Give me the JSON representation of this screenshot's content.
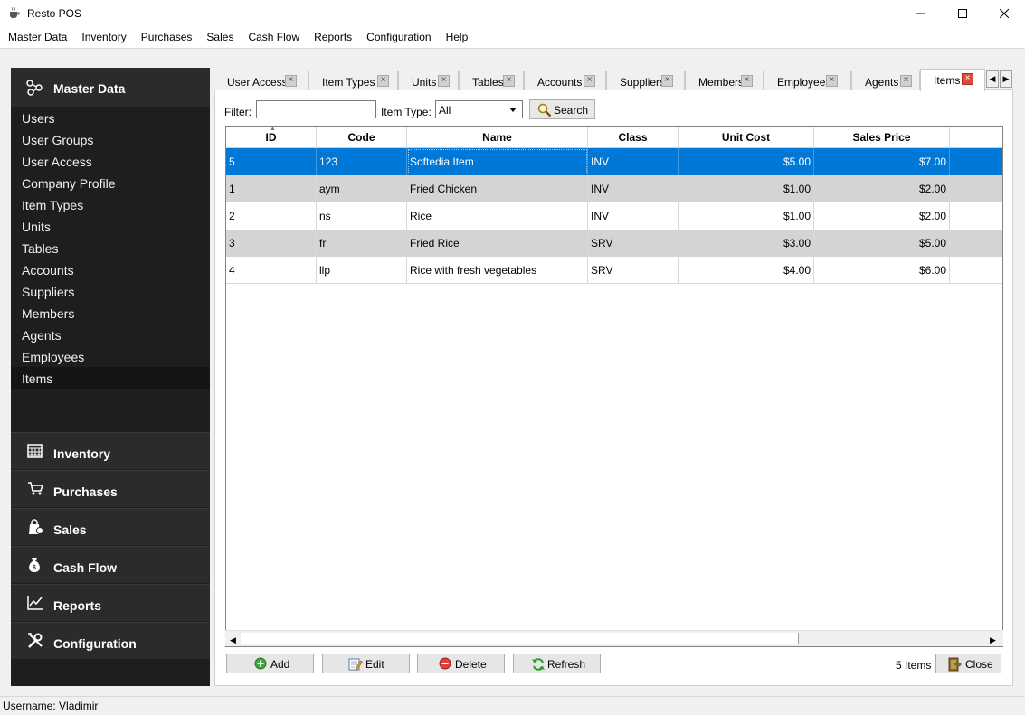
{
  "window": {
    "title": "Resto POS"
  },
  "menu": [
    "Master Data",
    "Inventory",
    "Purchases",
    "Sales",
    "Cash Flow",
    "Reports",
    "Configuration",
    "Help"
  ],
  "sidebar": {
    "header": "Master Data",
    "items": [
      "Users",
      "User Groups",
      "User Access",
      "Company Profile",
      "Item Types",
      "Units",
      "Tables",
      "Accounts",
      "Suppliers",
      "Members",
      "Agents",
      "Employees",
      "Items"
    ],
    "active_item": "Items",
    "sections": [
      "Inventory",
      "Purchases",
      "Sales",
      "Cash Flow",
      "Reports",
      "Configuration"
    ]
  },
  "tabs": [
    "User Access",
    "Item Types",
    "Units",
    "Tables",
    "Accounts",
    "Suppliers",
    "Members",
    "Employees",
    "Agents",
    "Items"
  ],
  "active_tab": "Items",
  "filter": {
    "filter_label": "Filter:",
    "filter_value": "",
    "item_type_label": "Item Type:",
    "item_type_value": "All",
    "search_label": "Search"
  },
  "table": {
    "columns": [
      "ID",
      "Code",
      "Name",
      "Class",
      "Unit Cost",
      "Sales Price"
    ],
    "rows": [
      [
        "5",
        "123",
        "Softedia Item",
        "INV",
        "$5.00",
        "$7.00"
      ],
      [
        "1",
        "aym",
        "Fried Chicken",
        "INV",
        "$1.00",
        "$2.00"
      ],
      [
        "2",
        "ns",
        "Rice",
        "INV",
        "$1.00",
        "$2.00"
      ],
      [
        "3",
        "fr",
        "Fried Rice",
        "SRV",
        "$3.00",
        "$5.00"
      ],
      [
        "4",
        "llp",
        "Rice with fresh vegetables",
        "SRV",
        "$4.00",
        "$6.00"
      ]
    ],
    "selected_row": 0
  },
  "buttons": {
    "add": "Add",
    "edit": "Edit",
    "delete": "Delete",
    "refresh": "Refresh",
    "close": "Close"
  },
  "item_count": "5 Items",
  "status": {
    "username": "Username: Vladimir"
  },
  "colors": {
    "selection": "#0078d7",
    "sidebar": "#1e1e1e",
    "close_tab": "#e04a3a"
  }
}
